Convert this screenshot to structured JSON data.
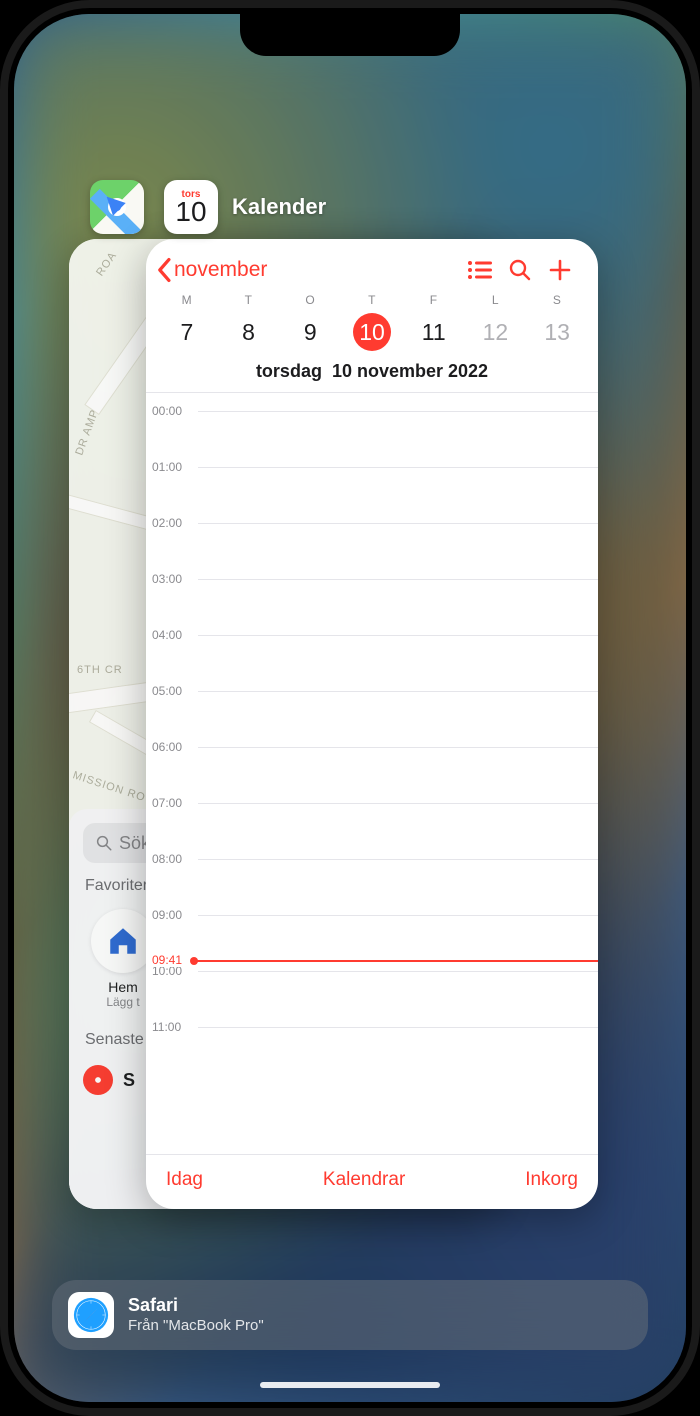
{
  "switcher": {
    "front_app_name": "Kalender",
    "front_app_icon_dow": "tors",
    "front_app_icon_day": "10"
  },
  "calendar": {
    "back_label": "november",
    "week_headers": [
      "M",
      "T",
      "O",
      "T",
      "F",
      "L",
      "S"
    ],
    "week_days": [
      {
        "num": "7",
        "today": false,
        "weekend": false
      },
      {
        "num": "8",
        "today": false,
        "weekend": false
      },
      {
        "num": "9",
        "today": false,
        "weekend": false
      },
      {
        "num": "10",
        "today": true,
        "weekend": false
      },
      {
        "num": "11",
        "today": false,
        "weekend": false
      },
      {
        "num": "12",
        "today": false,
        "weekend": true
      },
      {
        "num": "13",
        "today": false,
        "weekend": true
      }
    ],
    "date_prefix": "torsdag",
    "date_full": "10 november 2022",
    "hours": [
      "00:00",
      "01:00",
      "02:00",
      "03:00",
      "04:00",
      "05:00",
      "06:00",
      "07:00",
      "08:00",
      "09:00",
      "10:00",
      "11:00"
    ],
    "now_label": "09:41",
    "now_fraction": 0.807,
    "footer": {
      "today": "Idag",
      "calendars": "Kalendrar",
      "inbox": "Inkorg"
    }
  },
  "maps": {
    "search_placeholder": "Sök",
    "favorites_title": "Favoriter",
    "fav_home_label": "Hem",
    "fav_home_sub": "Lägg t",
    "recent_title": "Senaste",
    "recent_item_initial": "S",
    "road_labels": [
      "ROA",
      "DR AMP",
      "6TH CR",
      "MISSION RO"
    ]
  },
  "handoff": {
    "app": "Safari",
    "from": "Från \"MacBook Pro\""
  }
}
